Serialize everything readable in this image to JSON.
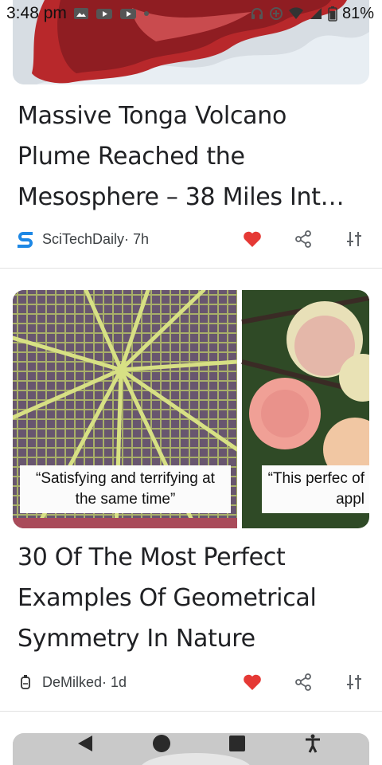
{
  "status_bar": {
    "time": "3:48 pm",
    "battery": "81%"
  },
  "card1": {
    "headline_lines": [
      "Massive Tonga Volcano",
      "Plume Reached the",
      "Mesosphere – 38 Miles Int…"
    ],
    "source": "SciTechDaily",
    "age": " · 7h",
    "logo_icon": "scitechdaily-logo-icon",
    "heart_color": "#e53935"
  },
  "card2": {
    "captions": [
      "“Satisfying and terrifying at the same time”",
      "“This perfec of appl"
    ],
    "headline_lines": [
      "30 Of The Most Perfect",
      "Examples Of Geometrical",
      "Symmetry In Nature"
    ],
    "source": "DeMilked",
    "age": " · 1d",
    "logo_icon": "demilked-logo-icon"
  },
  "nav": {
    "icons": [
      "back-icon",
      "home-icon",
      "recents-icon",
      "accessibility-icon"
    ]
  }
}
